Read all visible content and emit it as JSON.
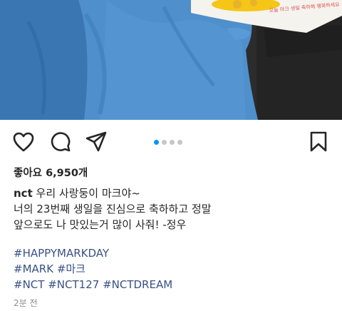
{
  "post": {
    "likes_text": "좋아요 6,950개",
    "username": "nct",
    "caption_first": " 우리 사랑둥이 마크야~",
    "caption_lines": [
      "너의 23번째 생일을 진심으로 축하하고 정말",
      "앞으로도 나 맛있는거 많이 사줘! -정우"
    ],
    "cake_text": "오늘 마크 생일 축하해 행복하세요",
    "hashtags": [
      [
        "#HAPPYMARKDAY"
      ],
      [
        "#MARK",
        "#마크"
      ],
      [
        "#NCT",
        "#NCT127",
        "#NCTDREAM"
      ]
    ],
    "time_ago": "2분 전"
  },
  "carousel": {
    "count": 4,
    "active_index": 0
  },
  "icons": {
    "like": "heart-icon",
    "comment": "comment-bubble-icon",
    "share": "paper-plane-icon",
    "save": "bookmark-icon"
  },
  "colors": {
    "link": "#385185",
    "active_dot": "#0095f6",
    "inactive_dot": "#c7c7c7",
    "time": "#8e8e8e"
  }
}
